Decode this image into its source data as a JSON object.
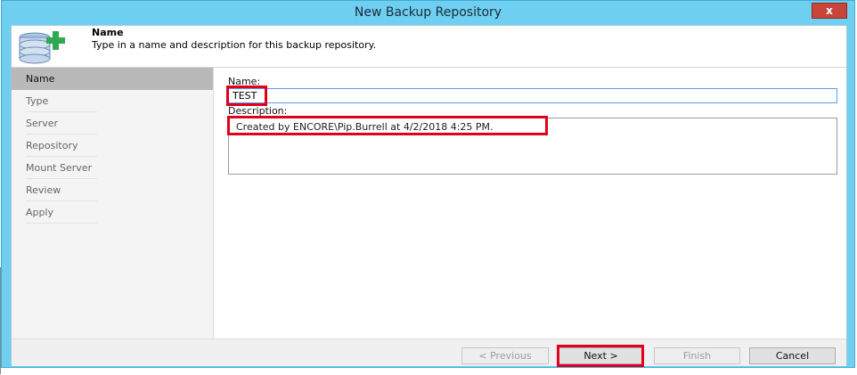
{
  "window": {
    "title": "New Backup Repository",
    "close_glyph": "x"
  },
  "header": {
    "icon": "database-add-icon",
    "title": "Name",
    "subtitle": "Type in a name and description for this backup repository."
  },
  "steps": [
    {
      "label": "Name",
      "active": true
    },
    {
      "label": "Type",
      "active": false
    },
    {
      "label": "Server",
      "active": false
    },
    {
      "label": "Repository",
      "active": false
    },
    {
      "label": "Mount Server",
      "active": false
    },
    {
      "label": "Review",
      "active": false
    },
    {
      "label": "Apply",
      "active": false
    }
  ],
  "form": {
    "name_label": "Name:",
    "name_value": "TEST",
    "description_label": "Description:",
    "description_value": "Created by ENCORE\\Pip.Burrell at 4/2/2018 4:25 PM."
  },
  "buttons": {
    "previous": "< Previous",
    "next": "Next >",
    "finish": "Finish",
    "cancel": "Cancel"
  },
  "colors": {
    "titlebar": "#6fcff0",
    "highlight": "#e0001b",
    "active_step": "#b9b9b9",
    "accent_green": "#2fa84f"
  }
}
